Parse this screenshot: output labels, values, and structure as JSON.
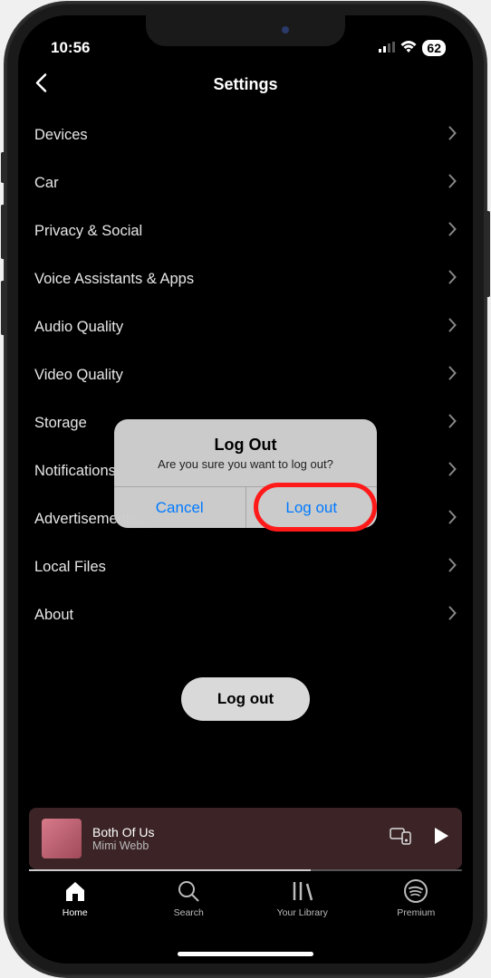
{
  "status_bar": {
    "time": "10:56",
    "battery": "62"
  },
  "header": {
    "title": "Settings"
  },
  "settings": {
    "items": [
      "Devices",
      "Car",
      "Privacy & Social",
      "Voice Assistants & Apps",
      "Audio Quality",
      "Video Quality",
      "Storage",
      "Notifications",
      "Advertisements",
      "Local Files",
      "About"
    ],
    "logout_label": "Log out"
  },
  "modal": {
    "title": "Log Out",
    "message": "Are you sure you want to log out?",
    "cancel": "Cancel",
    "confirm": "Log out"
  },
  "now_playing": {
    "title": "Both Of Us",
    "artist": "Mimi Webb"
  },
  "nav": {
    "home": "Home",
    "search": "Search",
    "library": "Your Library",
    "premium": "Premium"
  }
}
